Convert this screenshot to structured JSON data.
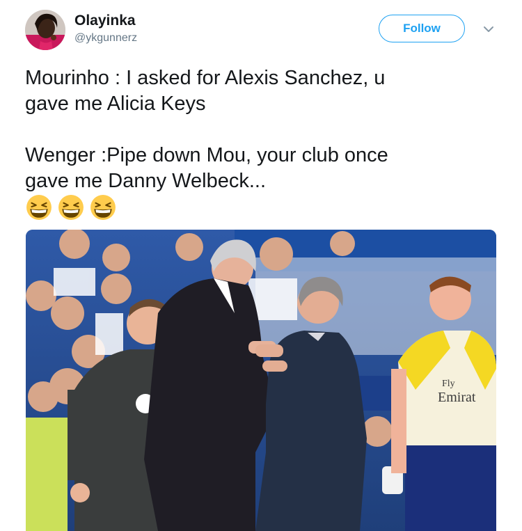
{
  "user": {
    "display_name": "Olayinka",
    "handle": "@ykgunnerz"
  },
  "header": {
    "follow_label": "Follow",
    "menu_icon": "chevron-down-icon"
  },
  "tweet": {
    "line1": "Mourinho : I asked for Alexis Sanchez, u",
    "line2": "gave me Alicia Keys",
    "line3": "Wenger :Pipe down Mou,  your club once",
    "line4": "gave me Danny Welbeck...",
    "emojis": [
      "grinning-squinting-face",
      "grinning-squinting-face",
      "grinning-squinting-face"
    ]
  },
  "photo": {
    "shirt_text_1": "Fly",
    "shirt_text_2": "Emirat"
  },
  "colors": {
    "accent": "#1da1f2",
    "text": "#14171a",
    "muted": "#657786",
    "emoji": "#ffcc4d"
  }
}
